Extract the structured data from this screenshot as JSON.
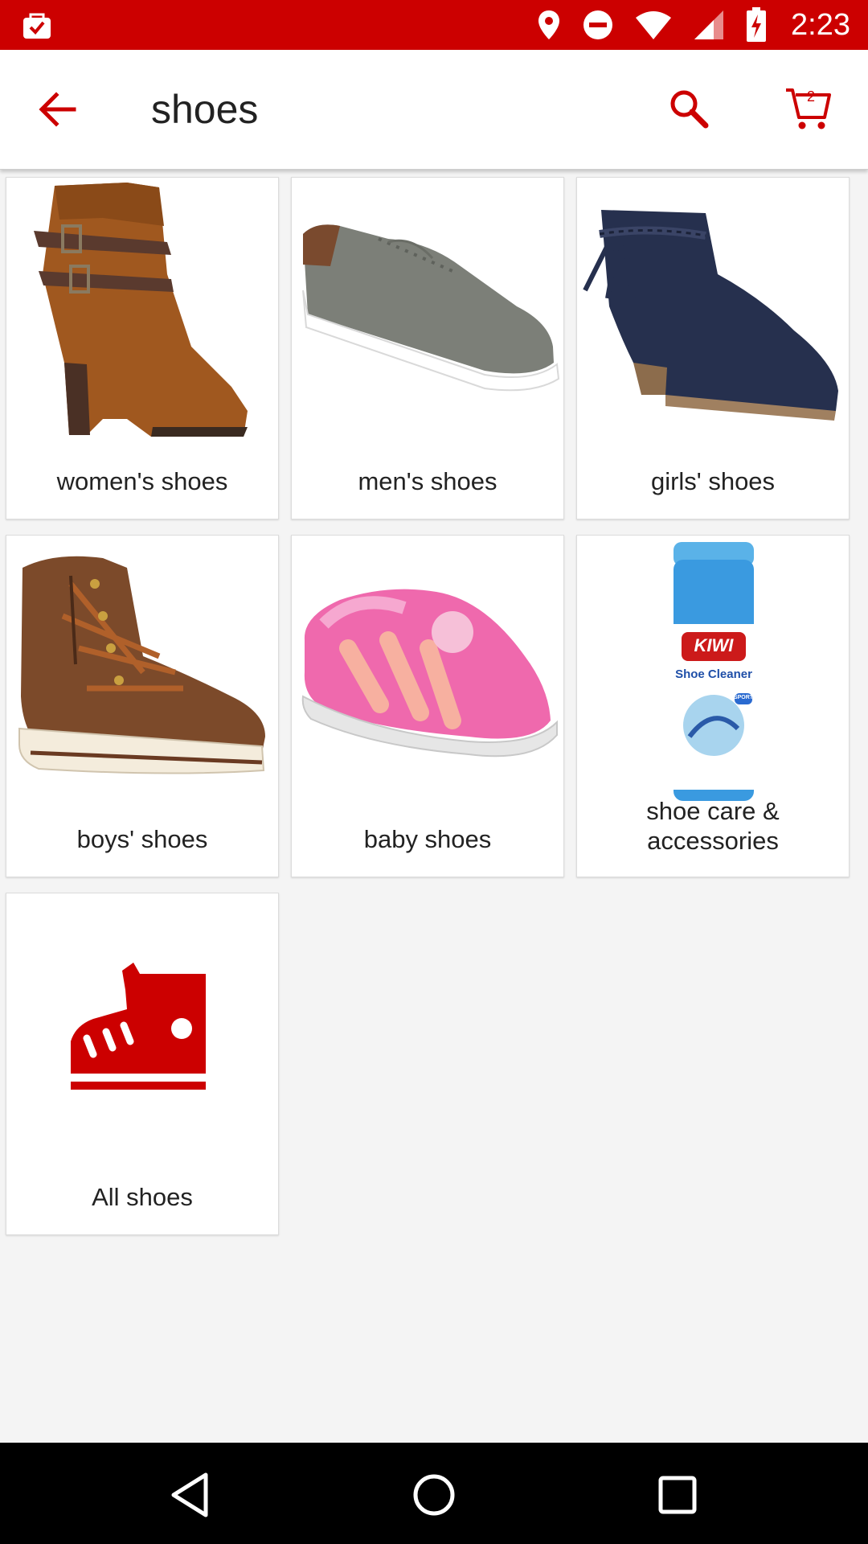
{
  "status_bar": {
    "time": "2:23",
    "icons": [
      "notification-bag-icon",
      "location-icon",
      "do-not-disturb-icon",
      "wifi-icon",
      "cell-signal-icon",
      "battery-charging-icon"
    ]
  },
  "app_bar": {
    "title": "shoes",
    "cart_count": "2",
    "accent_color": "#cc0000"
  },
  "categories": [
    {
      "label": "women's shoes",
      "image": "brown-ankle-boot"
    },
    {
      "label": "men's shoes",
      "image": "gray-sneaker"
    },
    {
      "label": "girls' shoes",
      "image": "navy-bootie"
    },
    {
      "label": "boys' shoes",
      "image": "brown-high-top"
    },
    {
      "label": "baby shoes",
      "image": "pink-sandal"
    },
    {
      "label": "shoe care &\naccessories",
      "image": "shoe-cleaner-can",
      "can_text": {
        "brand": "KIWI",
        "product": "Shoe Cleaner",
        "badge": "SPORT"
      }
    },
    {
      "label": "All shoes",
      "image": "red-sneaker-icon"
    }
  ],
  "nav_bar": {
    "buttons": [
      "back-nav",
      "home-nav",
      "recents-nav"
    ]
  }
}
